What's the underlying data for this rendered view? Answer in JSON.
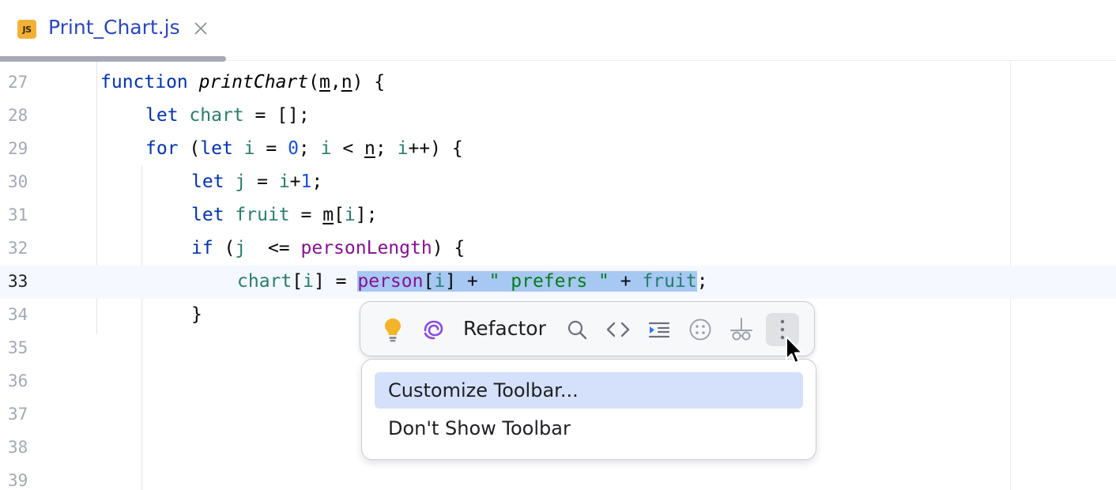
{
  "tab": {
    "icon_text": "JS",
    "file_name": "Print_Chart.js"
  },
  "editor": {
    "line_numbers": [
      "27",
      "28",
      "29",
      "30",
      "31",
      "32",
      "33",
      "34",
      "35",
      "36",
      "37",
      "38",
      "39"
    ],
    "lines": {
      "l27": {
        "a": "function",
        "b": "printChart",
        "c": "(",
        "d": "m",
        "e": ",",
        "f": "n",
        "g": ") {"
      },
      "l28": {
        "a": "let",
        "b": "chart",
        "c": " = [];"
      },
      "l29": {
        "a": "for",
        "b": " (",
        "c": "let",
        "d": "i",
        "e": " = ",
        "f": "0",
        "g": "; ",
        "h": "i",
        "i": " < ",
        "j": "n",
        "k": "; ",
        "l": "i",
        "m": "++) {"
      },
      "l30": {
        "a": "let",
        "b": "j",
        "c": " = ",
        "d": "i",
        "e": "+",
        "f": "1",
        "g": ";"
      },
      "l31": {
        "a": "let",
        "b": "fruit",
        "c": " = ",
        "d": "m",
        "e": "[",
        "f": "i",
        "g": "];"
      },
      "l32": {
        "a": "if",
        "b": " (",
        "c": "j",
        "d": "  <= ",
        "e": "personLength",
        "f": ") {"
      },
      "l33": {
        "a": "chart",
        "b": "[",
        "c": "i",
        "d": "] = ",
        "e": "person",
        "f": "[",
        "g": "i",
        "h": "] + ",
        "i": "\" prefers \"",
        "j": " + ",
        "k": "fruit",
        "l": ";"
      },
      "l34": {
        "a": "}"
      }
    }
  },
  "floating_toolbar": {
    "refactor_label": "Refactor",
    "icons": [
      "bulb-icon",
      "ai-assistant-icon",
      "search-icon",
      "code-icon",
      "indent-icon",
      "dots-circle-icon",
      "debugger-icon",
      "more-vertical-icon"
    ]
  },
  "menu": {
    "items": [
      "Customize Toolbar...",
      "Don't Show Toolbar"
    ]
  },
  "colors": {
    "keyword": "#0033b3",
    "variable": "#277f6b",
    "number": "#1750eb",
    "field": "#871094",
    "string": "#067d17",
    "selection": "#a6c8f3",
    "menu_highlight": "#d5e1fa",
    "tab_text": "#2a46c4"
  }
}
